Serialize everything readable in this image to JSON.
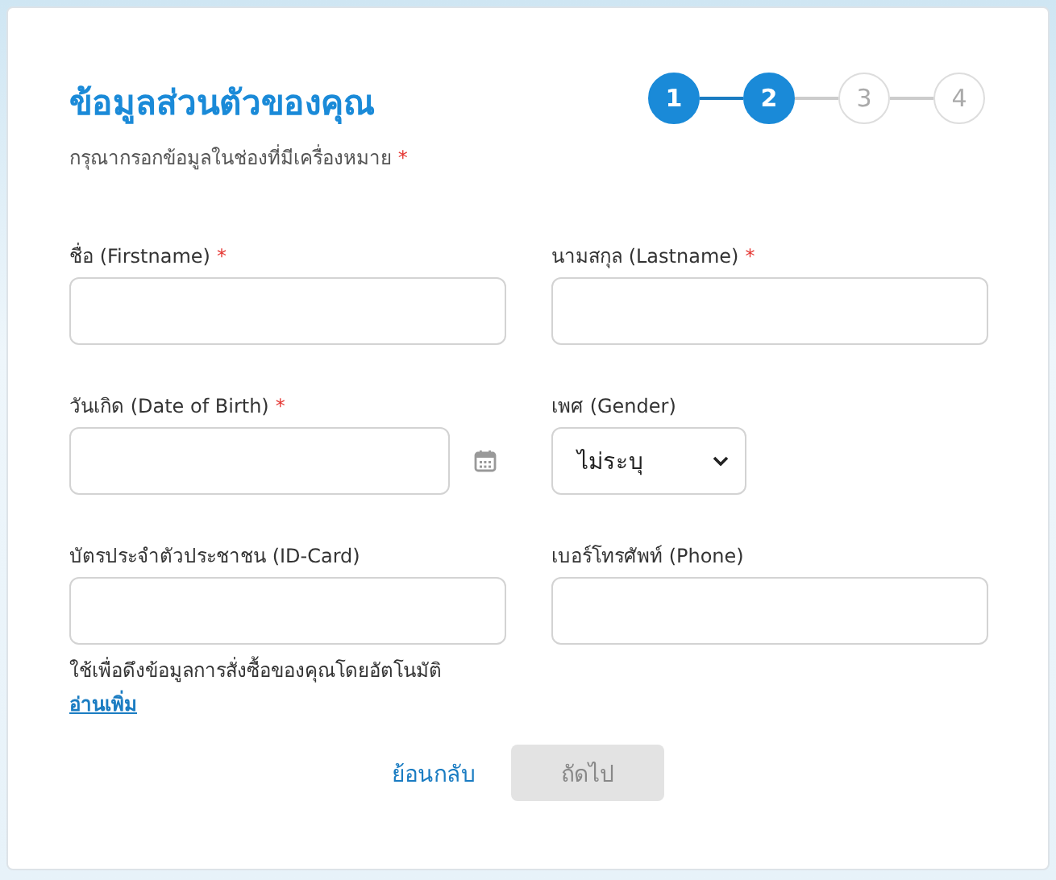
{
  "header": {
    "title": "ข้อมูลส่วนตัวของคุณ",
    "subtitle": "กรุณากรอกข้อมูลในช่องที่มีเครื่องหมาย",
    "subtitle_mark": "*"
  },
  "steps": [
    {
      "label": "1",
      "active": true
    },
    {
      "label": "2",
      "active": true
    },
    {
      "label": "3",
      "active": false
    },
    {
      "label": "4",
      "active": false
    }
  ],
  "fields": [
    {
      "kind": "text",
      "label": "ชื่อ (Firstname)",
      "required_mark": "*"
    },
    {
      "kind": "text",
      "label": "นามสกุล (Lastname)",
      "required_mark": "*"
    },
    {
      "kind": "date",
      "label": "วันเกิด (Date of Birth)",
      "required_mark": "*"
    },
    {
      "kind": "select",
      "label": "เพศ (Gender)",
      "value": "ไม่ระบุ"
    },
    {
      "kind": "text",
      "label": "บัตรประจำตัวประชาชน (ID-Card)",
      "help": "ใช้เพื่อดึงข้อมูลการสั่งซื้อของคุณโดยอัตโนมัติ",
      "link": "อ่านเพิ่ม"
    },
    {
      "kind": "text",
      "label": "เบอร์โทรศัพท์ (Phone)"
    }
  ],
  "actions": {
    "back": "ย้อนกลับ",
    "next": "ถัดไป",
    "next_disabled": true
  }
}
